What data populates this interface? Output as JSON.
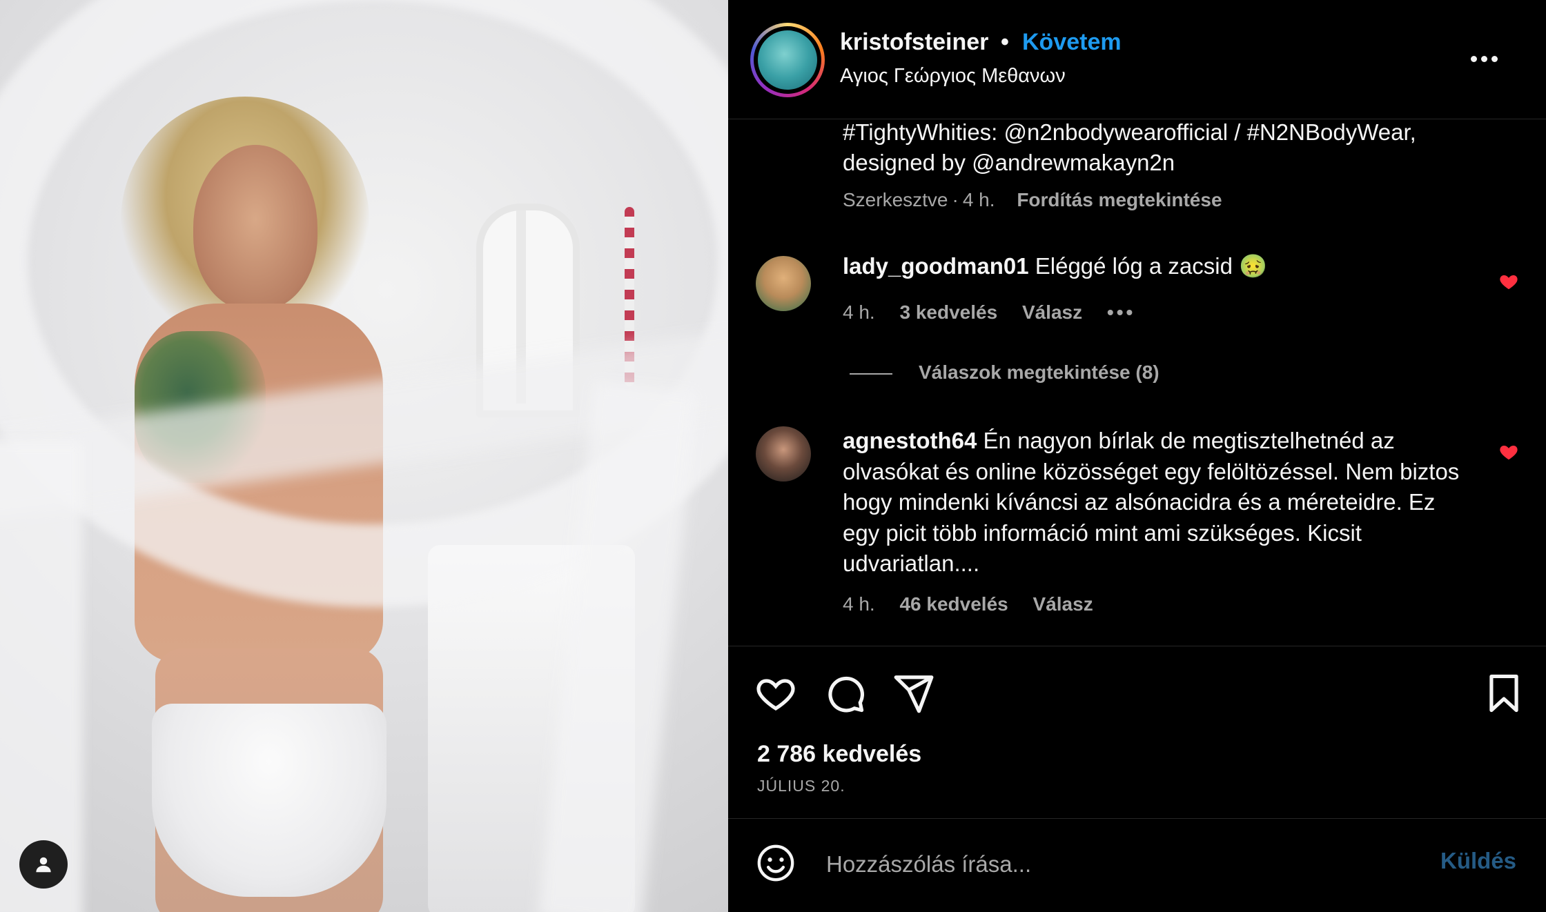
{
  "post": {
    "username": "kristofsteiner",
    "dot": "•",
    "follow_label": "Követem",
    "location": "Αγιος Γεώργιος Μεθανων",
    "caption_line1": "#TightyWhities: @n2nbodywearofficial / #N2NBodyWear,",
    "caption_line2": "designed by @andrewmakayn2n",
    "edited": "Szerkesztve",
    "edited_sep": "·",
    "edited_time": "4 h.",
    "translate_label": "Fordítás megtekintése"
  },
  "comments": [
    {
      "user": "lady_goodman01",
      "text": "Eléggé lóg a zacsid 🤢",
      "time": "4 h.",
      "likes": "3 kedvelés",
      "reply_label": "Válasz",
      "more": "•••",
      "view_replies": "Válaszok megtekintése (8)"
    },
    {
      "user": "agnestoth64",
      "text": "Én nagyon bírlak de megtisztelhetnéd az olvasókat és online közösséget egy felöltözéssel. Nem biztos hogy mindenki kíváncsi az alsónacidra és a méreteidre. Ez egy picit több információ mint ami szükséges. Kicsit udvariatlan....",
      "time": "4 h.",
      "likes": "46 kedvelés",
      "reply_label": "Válasz"
    }
  ],
  "footer": {
    "likes": "2 786 kedvelés",
    "date": "JÚLIUS 20.",
    "comment_placeholder": "Hozzászólás írása...",
    "send_label": "Küldés"
  },
  "icons": {
    "heart": "heart-icon",
    "comment": "comment-icon",
    "share": "share-icon",
    "bookmark": "bookmark-icon",
    "emoji": "emoji-icon",
    "more": "more-options-icon",
    "tag": "user-tag-icon"
  },
  "colors": {
    "accent": "#1e9bf0",
    "like": "#ff3040",
    "muted": "#a8a8a8",
    "send_disabled": "#255b85"
  }
}
